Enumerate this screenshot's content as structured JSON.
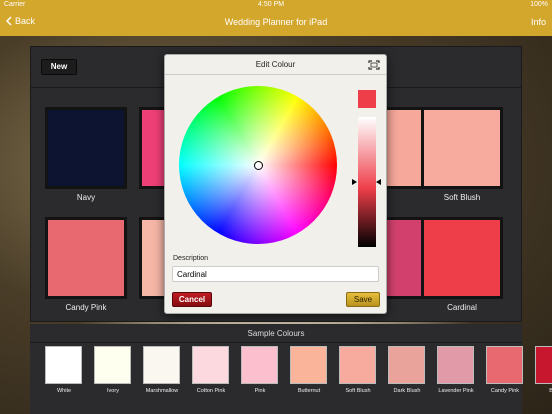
{
  "status_bar": {
    "carrier": "Carrier",
    "time": "4:50 PM",
    "battery": "100%"
  },
  "nav": {
    "back_label": "Back",
    "title": "Wedding Planner for iPad",
    "info_label": "Info"
  },
  "toolbar": {
    "new_label": "New"
  },
  "swatches": [
    {
      "name": "Navy",
      "color": "#0c1431"
    },
    {
      "name": "",
      "color": "#ef3f77"
    },
    {
      "name": "",
      "color": "#f6a89b"
    },
    {
      "name": "Soft Blush",
      "color": "#f6ab9e"
    },
    {
      "name": "Candy Pink",
      "color": "#e96970"
    },
    {
      "name": "",
      "color": "#f6b6a7"
    },
    {
      "name": "",
      "color": "#d2416d"
    },
    {
      "name": "Cardinal",
      "color": "#ee3e4a"
    }
  ],
  "dialog": {
    "title": "Edit Colour",
    "description_label": "Description",
    "description_value": "Cardinal",
    "cancel_label": "Cancel",
    "save_label": "Save",
    "selected_color": "#ee3e4a"
  },
  "samples": {
    "title": "Sample Colours",
    "items": [
      {
        "name": "White",
        "color": "#ffffff"
      },
      {
        "name": "Ivory",
        "color": "#fffff0"
      },
      {
        "name": "Marshmallow",
        "color": "#f9f7ef"
      },
      {
        "name": "Cotton Pink",
        "color": "#fcd9df"
      },
      {
        "name": "Pink",
        "color": "#fbbfce"
      },
      {
        "name": "Butternut",
        "color": "#f9b49a"
      },
      {
        "name": "Soft Blush",
        "color": "#f6ab9e"
      },
      {
        "name": "Dark Blush",
        "color": "#e9a39b"
      },
      {
        "name": "Lavender Pink",
        "color": "#e19aa8"
      },
      {
        "name": "Candy Pink",
        "color": "#e96970"
      },
      {
        "name": "Bric",
        "color": "#c7172f"
      }
    ]
  }
}
